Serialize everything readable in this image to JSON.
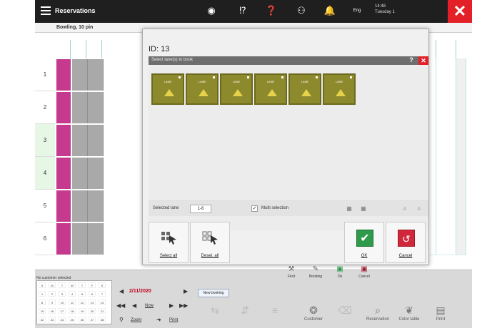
{
  "topbar": {
    "title": "Reservations",
    "user_line1": "14:48",
    "user_line2": "Tuesday 1",
    "lang": "Eng",
    "icons": [
      "circle-icon",
      "help-icon",
      "question-icon",
      "users-icon",
      "bell-icon"
    ]
  },
  "subbar": {
    "label": "Bowling, 10 pin"
  },
  "rows": [
    "1",
    "2",
    "3",
    "4",
    "5",
    "6"
  ],
  "dialog": {
    "id_label": "ID: 13",
    "title": "Select lane(s) to book",
    "tile_label": "LANE",
    "tiles": [
      "Lane 1",
      "Lane 2",
      "Lane 3",
      "Lane 4",
      "Lane 5",
      "Lane 6"
    ],
    "selected_lane_label": "Selected lane",
    "selected_lane_value": "1-6",
    "multi_selection_label": "Multi selection",
    "multi_selection_checked": true,
    "select_all": "Select all",
    "deselect_all": "Desel. all",
    "ok": "OK",
    "cancel": "Cancel"
  },
  "bottom": {
    "no_customer": "No customer selected",
    "date": "2/11/2020",
    "now": "Now",
    "zoom": "Zoom",
    "print_small": "Print",
    "new_booking": "New booking",
    "toolbar_small": [
      "Find",
      "Booking",
      "Ok",
      "Cancel"
    ],
    "toolbar_big": [
      "Customer",
      "Reservation",
      "Color table",
      "Print"
    ],
    "cal_days": [
      "S",
      "M",
      "T",
      "W",
      "T",
      "F",
      "S",
      "1",
      "2",
      "3",
      "4",
      "5",
      "6",
      "7",
      "8",
      "9",
      "10",
      "11",
      "12",
      "13",
      "14",
      "15",
      "16",
      "17",
      "18",
      "19",
      "20",
      "21",
      "22",
      "23",
      "24",
      "25",
      "26",
      "27",
      "28"
    ]
  },
  "colors": {
    "accent_red": "#e32028",
    "lane_tile": "#8c8a2c",
    "ok_green": "#2e9a4a",
    "cancel_red": "#d0283a",
    "magenta": "#c5398e"
  }
}
